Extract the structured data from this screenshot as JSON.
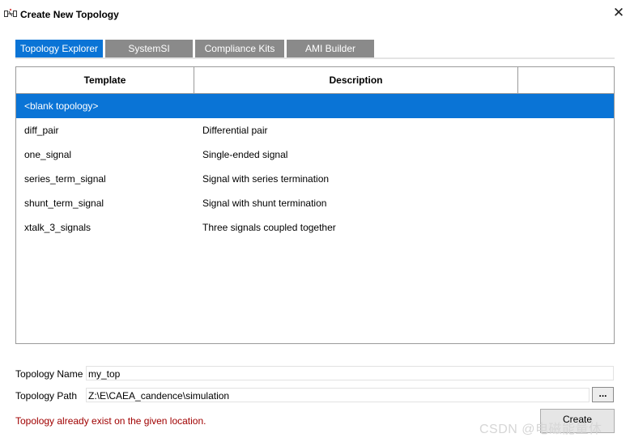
{
  "window": {
    "title": "Create New Topology"
  },
  "tabs": [
    {
      "label": "Topology Explorer",
      "active": true
    },
    {
      "label": "SystemSI",
      "active": false
    },
    {
      "label": "Compliance Kits",
      "active": false
    },
    {
      "label": "AMI Builder",
      "active": false
    }
  ],
  "table": {
    "columns": [
      "Template",
      "Description",
      ""
    ],
    "rows": [
      {
        "template": "<blank topology>",
        "description": "",
        "selected": true
      },
      {
        "template": "diff_pair",
        "description": "Differential pair",
        "selected": false
      },
      {
        "template": "one_signal",
        "description": "Single-ended signal",
        "selected": false
      },
      {
        "template": "series_term_signal",
        "description": "Signal with series termination",
        "selected": false
      },
      {
        "template": "shunt_term_signal",
        "description": "Signal with shunt termination",
        "selected": false
      },
      {
        "template": "xtalk_3_signals",
        "description": "Three signals coupled together",
        "selected": false
      }
    ]
  },
  "form": {
    "name_label": "Topology Name",
    "name_value": "my_top",
    "path_label": "Topology Path",
    "path_value": "Z:\\E\\CAEA_candence\\simulation",
    "browse_label": "...",
    "error": "Topology already exist on the given location.",
    "create_label": "Create"
  },
  "watermark": "CSDN @电磁能量体",
  "colors": {
    "accent": "#0a74d6",
    "error": "#a00000",
    "tab_inactive": "#8a8a8a"
  }
}
